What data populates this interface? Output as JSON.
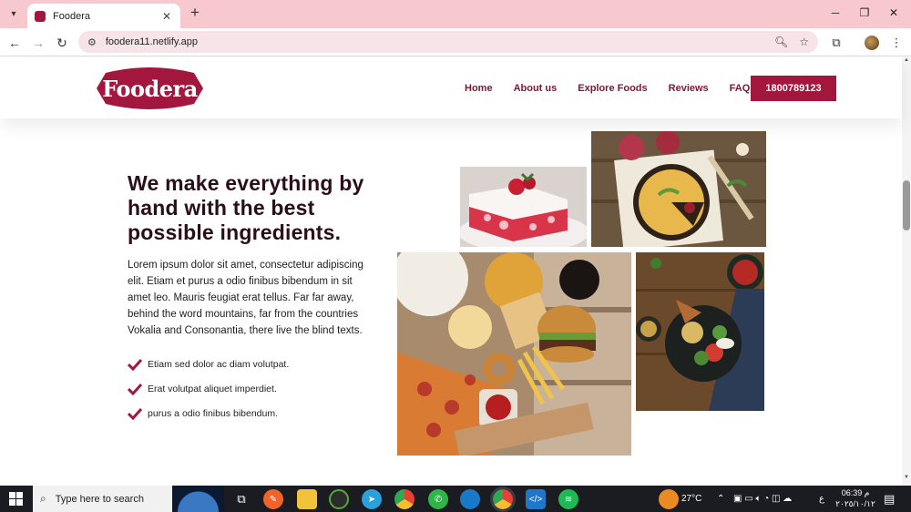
{
  "browser": {
    "tab_title": "Foodera",
    "url": "foodera11.netlify.app",
    "new_tab_symbol": "+",
    "close_symbol": "✕"
  },
  "site": {
    "logo_text": "Foodera",
    "nav": [
      "Home",
      "About us",
      "Explore Foods",
      "Reviews",
      "FAQ"
    ],
    "phone": "1800789123",
    "brand_color": "#a3173f"
  },
  "main": {
    "headline": "We make everything by hand with the best possible ingredients.",
    "paragraph": "Lorem ipsum dolor sit amet, consectetur adipiscing elit. Etiam et purus a odio finibus bibendum in sit amet leo. Mauris feugiat erat tellus. Far far away, behind the word mountains, far from the countries Vokalia and Consonantia, there live the blind texts.",
    "checklist": [
      "Etiam sed dolor ac diam volutpat.",
      "Erat volutpat aliquet imperdiet.",
      "purus a odio finibus bibendum."
    ]
  },
  "taskbar": {
    "search_placeholder": "Type here to search",
    "weather": "27°C",
    "time": "06:39 م",
    "date": "٢٠٢٥/١٠/١٢",
    "lang": "ع"
  }
}
